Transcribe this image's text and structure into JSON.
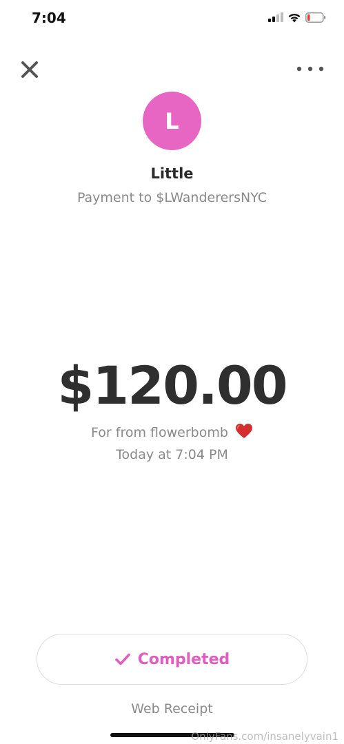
{
  "status_bar": {
    "time": "7:04",
    "icons": [
      "cellular-signal-icon",
      "wifi-icon",
      "battery-low-icon"
    ]
  },
  "header": {
    "close_icon": "close-icon",
    "more_icon": "more-icon"
  },
  "recipient": {
    "avatar_initial": "L",
    "avatar_color": "#e866c3",
    "name": "Little",
    "payment_to": "Payment to $LWanderersNYC"
  },
  "payment": {
    "amount": "$120.00",
    "note": "For from flowerbomb",
    "note_emoji": "red-heart-icon",
    "timestamp": "Today at 7:04 PM"
  },
  "status": {
    "label": "Completed",
    "icon": "check-icon",
    "accent_color": "#e05ec0"
  },
  "footer": {
    "web_receipt": "Web Receipt",
    "watermark": "OnlyFans.com/insanelyvain1"
  }
}
